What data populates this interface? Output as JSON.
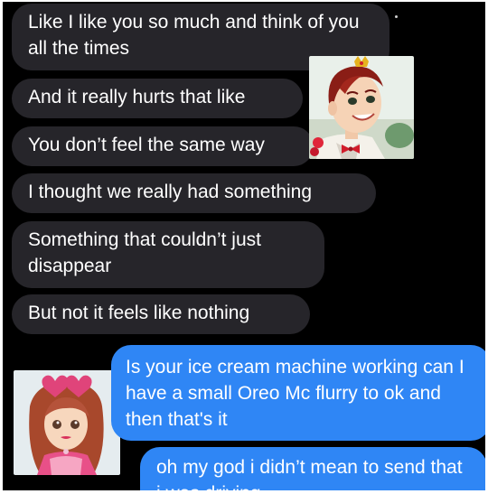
{
  "conversation": {
    "received": [
      {
        "text": "Like I like you so much and think of you all the times"
      },
      {
        "text": "And it really hurts that like"
      },
      {
        "text": "You don’t feel the same way"
      },
      {
        "text": "I thought we really had something"
      },
      {
        "text": "Something that couldn’t just disappear"
      },
      {
        "text": "But not it feels like nothing"
      }
    ],
    "sent": [
      {
        "text": "Is your ice cream machine working can I have a small Oreo Mc flurry to ok and then that's it"
      },
      {
        "text": "oh my god i didn’t mean to send that i was driving"
      }
    ]
  },
  "stickers": {
    "prince": {
      "icon": "prince-character-sticker-icon"
    },
    "princess": {
      "icon": "princess-character-sticker-icon"
    }
  },
  "colors": {
    "background": "#000000",
    "received_bubble": "#26252a",
    "sent_bubble": "#2f86f5",
    "text": "#ffffff"
  }
}
